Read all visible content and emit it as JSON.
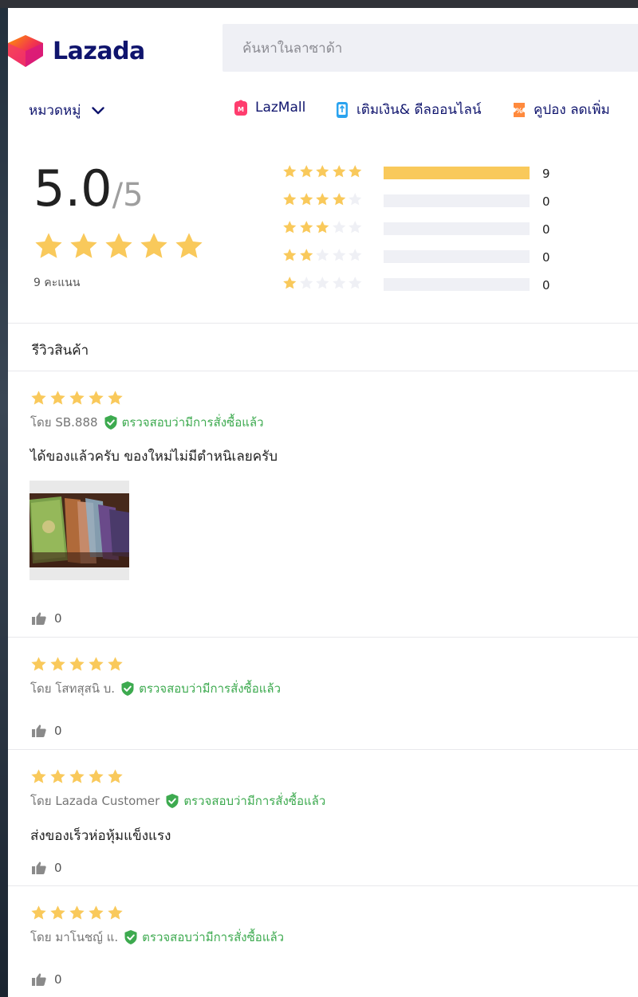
{
  "header": {
    "logo_text": "Lazada",
    "search_placeholder": "ค้นหาในลาซาด้า"
  },
  "nav": {
    "category_label": "หมวดหมู่",
    "links": [
      {
        "label": "LazMall",
        "icon": "lazmall-icon"
      },
      {
        "label": "เติมเงิน& ดีลออนไลน์",
        "icon": "topup-phone-icon"
      },
      {
        "label": "คูปอง ลดเพิ่ม",
        "icon": "coupon-icon"
      }
    ]
  },
  "rating_summary": {
    "score": "5.0",
    "max": "/5",
    "rating_value": 5,
    "count_label": "9 คะแนน",
    "distribution": [
      {
        "stars": 5,
        "count": "9",
        "fraction": 1.0
      },
      {
        "stars": 4,
        "count": "0",
        "fraction": 0
      },
      {
        "stars": 3,
        "count": "0",
        "fraction": 0
      },
      {
        "stars": 2,
        "count": "0",
        "fraction": 0
      },
      {
        "stars": 1,
        "count": "0",
        "fraction": 0
      }
    ]
  },
  "reviews_section": {
    "title": "รีวิวสินค้า"
  },
  "reviews": [
    {
      "rating": 5,
      "author": "โดย SB.888",
      "verified": "ตรวจสอบว่ามีการสั่งซื้อแล้ว",
      "text": "ได้ของแล้วครับ ของใหม่ไม่มีตำหนิเลยครับ",
      "likes": "0"
    },
    {
      "rating": 5,
      "author": "โดย โสทสุสนิ บ.",
      "verified": "ตรวจสอบว่ามีการสั่งซื้อแล้ว",
      "text": "",
      "likes": "0"
    },
    {
      "rating": 5,
      "author": "โดย Lazada Customer",
      "verified": "ตรวจสอบว่ามีการสั่งซื้อแล้ว",
      "text": "ส่งของเร็วห่อหุ้มแข็งแรง",
      "likes": "0"
    },
    {
      "rating": 5,
      "author": "โดย มาโนชญ์ แ.",
      "verified": "ตรวจสอบว่ามีการสั่งซื้อแล้ว",
      "text": "",
      "likes": "0"
    }
  ],
  "colors": {
    "star": "#f9c95b",
    "star_empty": "#eff0f5",
    "brand_navy": "#0f146d",
    "verified_green": "#3daa4f"
  }
}
